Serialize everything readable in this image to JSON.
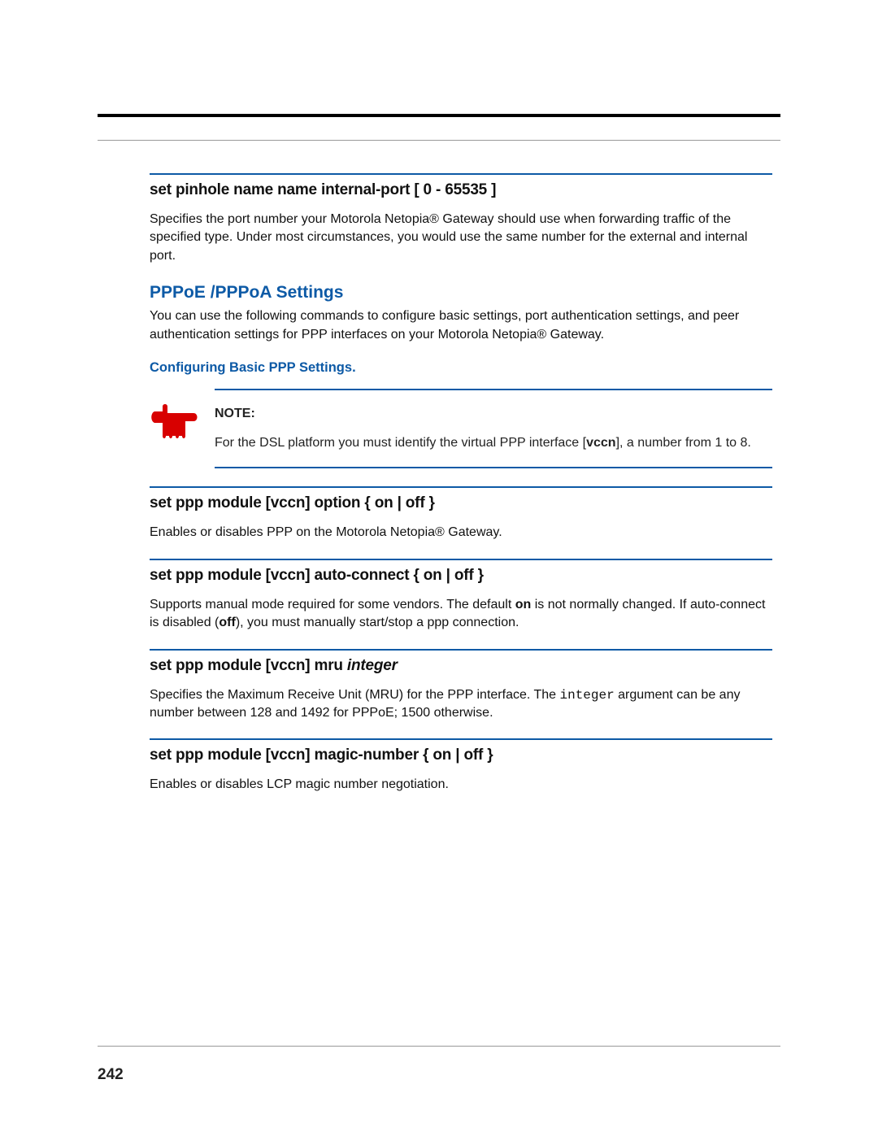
{
  "page_number": "242",
  "sec1": {
    "cmd": "set pinhole name name internal-port [ 0 - 65535 ]",
    "desc": "Specifies the port number your Motorola Netopia® Gateway should use when forwarding traffic of the specified type. Under most circumstances, you would use the same number for the external and internal port."
  },
  "pppoe": {
    "heading": "PPPoE /PPPoA Settings",
    "intro": "You can use the following commands to configure basic settings, port authentication settings, and peer authentication settings for PPP interfaces on your Motorola Netopia® Gateway.",
    "subhead": "Configuring Basic PPP Settings."
  },
  "note": {
    "label": "NOTE:",
    "text_pre": "For the DSL platform you must identify the virtual PPP interface [",
    "text_bold": "vccn",
    "text_post": "], a number from 1 to 8."
  },
  "sec2": {
    "cmd": "set ppp module [vccn] option { on | off }",
    "desc": "Enables or disables PPP on the Motorola Netopia® Gateway."
  },
  "sec3": {
    "cmd": "set ppp module [vccn] auto-connect { on | off }",
    "desc_pre": "Supports manual mode required for some vendors. The default ",
    "desc_on": "on",
    "desc_mid": " is not normally changed. If auto-connect is disabled (",
    "desc_off": "off",
    "desc_post": "), you must manually start/stop a ppp connection."
  },
  "sec4": {
    "cmd_pre": "set ppp module [vccn] mru ",
    "cmd_ital": "integer",
    "desc_pre": "Specifies the Maximum Receive Unit (MRU) for the PPP interface. The ",
    "desc_mono": "integer",
    "desc_post": " argument can be any number between 128 and 1492 for PPPoE; 1500 otherwise."
  },
  "sec5": {
    "cmd": "set ppp module [vccn] magic-number { on | off }",
    "desc": "Enables or disables LCP magic number negotiation."
  }
}
